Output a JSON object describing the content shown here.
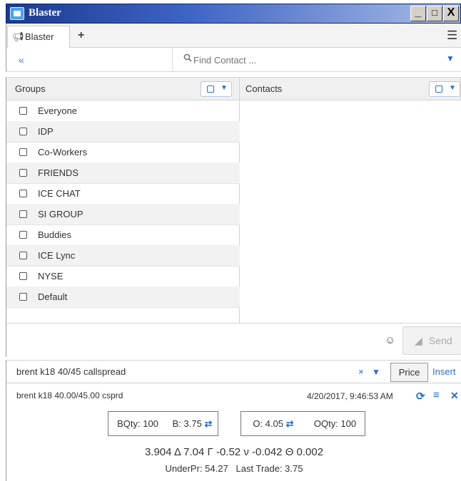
{
  "window": {
    "title": "Blaster",
    "controls": [
      "_",
      "□",
      "X"
    ]
  },
  "tabs": [
    {
      "label": "Blaster"
    }
  ],
  "search": {
    "placeholder": "Find Contact ..."
  },
  "groups": {
    "header": "Groups",
    "items": [
      "Everyone",
      "IDP",
      "Co-Workers",
      "FRIENDS",
      "ICE CHAT",
      "SI GROUP",
      "Buddies",
      "ICE Lync",
      "NYSE",
      "Default"
    ]
  },
  "contacts": {
    "header": "Contacts"
  },
  "compose": {
    "send_label": "Send"
  },
  "request": {
    "value": "brent k18 40/45 callspread",
    "clear": "×",
    "price_label": "Price",
    "insert_label": "Insert"
  },
  "quote": {
    "description": "brent k18 40.00/45.00 csprd",
    "timestamp": "4/20/2017, 9:46:53 AM",
    "bqty": "BQty: 100",
    "bid": "B: 3.75",
    "offer": "O: 4.05",
    "oqty": "OQty: 100",
    "greeks": "3.904  Δ 7.04  Γ -0.52  ν -0.042  Θ 0.002",
    "under_price": "UnderPr: 54.27",
    "last_trade": "Last Trade: 3.75"
  },
  "icons": {
    "tab": "megaphone-icon",
    "add": "plus-icon",
    "menu": "hamburger-icon",
    "collapse": "double-chevron-left-icon",
    "search": "magnifier-icon",
    "emoji": "smiley-icon",
    "send": "paper-plane-icon",
    "refresh": "refresh-icon",
    "list": "list-icon",
    "close": "close-icon"
  },
  "colors": {
    "accent": "#2a6fc9",
    "titlebar": "#1b3a8f"
  }
}
